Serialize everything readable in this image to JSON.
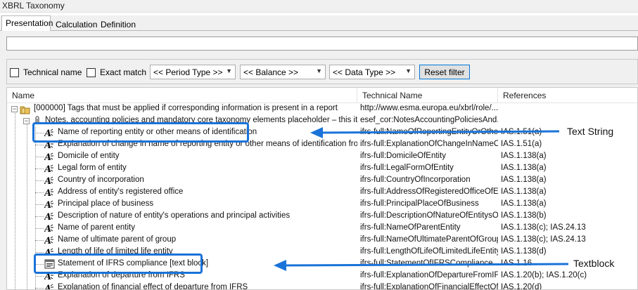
{
  "window": {
    "title": "XBRL Taxonomy"
  },
  "tabs": [
    {
      "label": "Presentation",
      "active": true
    },
    {
      "label": "Calculation",
      "active": false
    },
    {
      "label": "Definition",
      "active": false
    }
  ],
  "search": {
    "value": ""
  },
  "filters": {
    "technical_name": {
      "label": "Technical name",
      "checked": false
    },
    "exact_match": {
      "label": "Exact match",
      "checked": false
    },
    "period_type": "<< Period Type >>",
    "balance": "<< Balance >>",
    "data_type": "<< Data Type >>",
    "reset_label": "Reset filter"
  },
  "columns": [
    "Name",
    "Technical Name",
    "References"
  ],
  "rows": [
    {
      "name": "[000000] Tags that must be applied if corresponding information is present in a report",
      "technical": "http://www.esma.europa.eu/xbrl/role/...",
      "refs": ""
    },
    {
      "name": "Notes, accounting policies and mandatory core taxonomy elements placeholder – this item ...",
      "technical": "esef_cor:NotesAccountingPoliciesAnd...",
      "refs": ""
    },
    {
      "name": "Name of reporting entity or other means of identification",
      "technical": "ifrs-full:NameOfReportingEntityOrOther...",
      "refs": "IAS.1.51(a)"
    },
    {
      "name": "Explanation of change in name of reporting entity or other means of identification from e...",
      "technical": "ifrs-full:ExplanationOfChangeInNameOf...",
      "refs": "IAS.1.51(a)"
    },
    {
      "name": "Domicile of entity",
      "technical": "ifrs-full:DomicileOfEntity",
      "refs": "IAS.1.138(a)"
    },
    {
      "name": "Legal form of entity",
      "technical": "ifrs-full:LegalFormOfEntity",
      "refs": "IAS.1.138(a)"
    },
    {
      "name": "Country of incorporation",
      "technical": "ifrs-full:CountryOfIncorporation",
      "refs": "IAS.1.138(a)"
    },
    {
      "name": "Address of entity's registered office",
      "technical": "ifrs-full:AddressOfRegisteredOfficeOfEn...",
      "refs": "IAS.1.138(a)"
    },
    {
      "name": "Principal place of business",
      "technical": "ifrs-full:PrincipalPlaceOfBusiness",
      "refs": "IAS.1.138(a)"
    },
    {
      "name": "Description of nature of entity's operations and principal activities",
      "technical": "ifrs-full:DescriptionOfNatureOfEntitysOp...",
      "refs": "IAS.1.138(b)"
    },
    {
      "name": "Name of parent entity",
      "technical": "ifrs-full:NameOfParentEntity",
      "refs": "IAS.1.138(c); IAS.24.13"
    },
    {
      "name": "Name of ultimate parent of group",
      "technical": "ifrs-full:NameOfUltimateParentOfGroup",
      "refs": "IAS.1.138(c); IAS.24.13"
    },
    {
      "name": "Length of life of limited life entity",
      "technical": "ifrs-full:LengthOfLifeOfLimitedLifeEntity",
      "refs": "IAS.1.138(d)"
    },
    {
      "name": "Statement of IFRS compliance [text block]",
      "technical": "ifrs-full:StatementOfIFRSCompliance",
      "refs": "IAS.1.16"
    },
    {
      "name": "Explanation of departure from IFRS",
      "technical": "ifrs-full:ExplanationOfDepartureFromIFRS",
      "refs": "IAS.1.20(b); IAS.1.20(c)"
    },
    {
      "name": "Explanation of financial effect of departure from IFRS",
      "technical": "ifrs-full:ExplanationOfFinancialEffectOf...",
      "refs": "IAS.1.20(d)"
    }
  ],
  "annotations": {
    "text_string": "Text String",
    "textblock": "Textblock",
    "color": "#1a73d9"
  }
}
